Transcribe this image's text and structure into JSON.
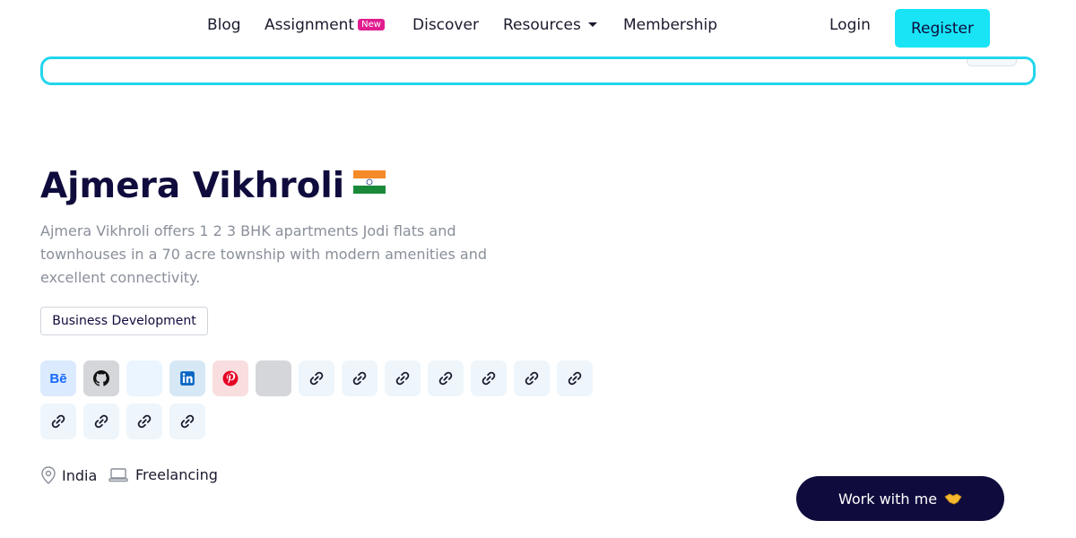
{
  "nav": {
    "blog": "Blog",
    "assignment": "Assignment",
    "assignment_badge": "New",
    "discover": "Discover",
    "resources": "Resources",
    "membership": "Membership",
    "login": "Login",
    "register": "Register"
  },
  "search": {
    "placeholder": ""
  },
  "profile": {
    "name": "Ajmera Vikhroli",
    "flag_icon": "india-flag-icon",
    "description": "Ajmera Vikhroli offers 1 2 3 BHK apartments Jodi flats and townhouses in a 70 acre township with modern amenities and excellent connectivity.",
    "tag": "Business Development",
    "location": "India",
    "work_type": "Freelancing",
    "cta": "Work with me"
  },
  "social_links": [
    {
      "icon": "behance-icon",
      "label": "Bē"
    },
    {
      "icon": "github-icon"
    },
    {
      "icon": "blank-icon"
    },
    {
      "icon": "linkedin-icon"
    },
    {
      "icon": "pinterest-icon"
    },
    {
      "icon": "blank-icon"
    },
    {
      "icon": "link-icon"
    },
    {
      "icon": "link-icon"
    },
    {
      "icon": "link-icon"
    },
    {
      "icon": "link-icon"
    },
    {
      "icon": "link-icon"
    },
    {
      "icon": "link-icon"
    },
    {
      "icon": "link-icon"
    },
    {
      "icon": "link-icon"
    },
    {
      "icon": "link-icon"
    },
    {
      "icon": "link-icon"
    },
    {
      "icon": "link-icon"
    }
  ],
  "colors": {
    "accent": "#18e4f6",
    "navy": "#0f0c3d",
    "badge": "#e11d8f"
  }
}
